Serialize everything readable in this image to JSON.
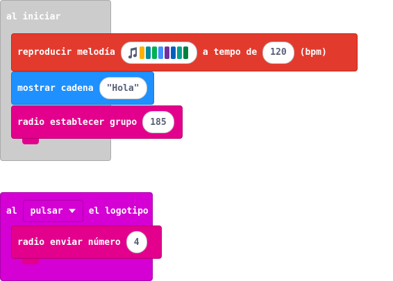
{
  "on_start": {
    "label": "al iniciar"
  },
  "play_melody": {
    "label": "reproducir melodía",
    "tempo_label": "a tempo de",
    "tempo_value": "120",
    "unit": "(bpm)",
    "music_icon": "music-note-icon",
    "note_colors": [
      "#ffb000",
      "#008aa0",
      "#00b050",
      "#4090ff",
      "#7030a0",
      "#0060c0",
      "#00a090",
      "#008040"
    ]
  },
  "show_string": {
    "label": "mostrar cadena",
    "value": "\"Hola\""
  },
  "radio_set_group": {
    "label": "radio establecer grupo",
    "value": "185"
  },
  "on_logo": {
    "prefix": "al",
    "event": "pulsar",
    "suffix": "el logotipo"
  },
  "radio_send_number": {
    "label": "radio enviar número",
    "value": "4"
  },
  "colors": {
    "start_hat": "#cccccc",
    "music": "#e23b2e",
    "basic": "#1e90ff",
    "radio": "#e3008c",
    "input": "#d400d4"
  }
}
